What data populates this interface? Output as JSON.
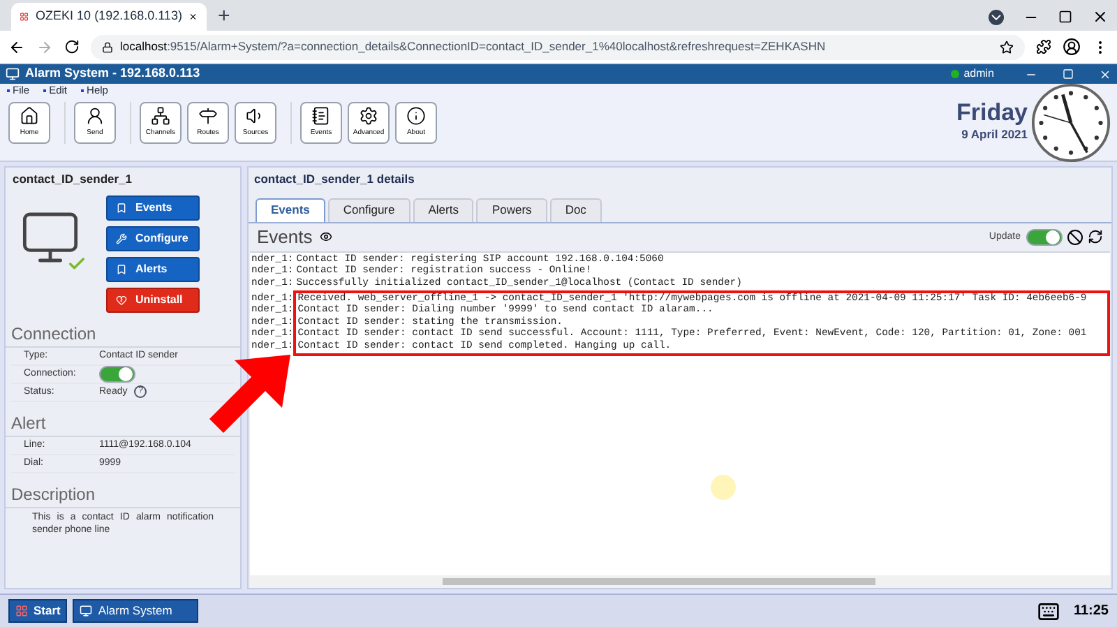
{
  "browser": {
    "tab_title": "OZEKI 10 (192.168.0.113)",
    "new_tab": "+",
    "url_host": "localhost",
    "url_rest": ":9515/Alarm+System/?a=connection_details&ConnectionID=contact_ID_sender_1%40localhost&refreshrequest=ZEHKASHN"
  },
  "app": {
    "title": "Alarm System - 192.168.0.113",
    "user": "admin",
    "user_online": true
  },
  "menu": [
    "File",
    "Edit",
    "Help"
  ],
  "toolbar_groups": [
    [
      {
        "label": "Home",
        "kind": "home"
      }
    ],
    [
      {
        "label": "Send",
        "kind": "send"
      }
    ],
    [
      {
        "label": "Channels",
        "kind": "channels"
      },
      {
        "label": "Routes",
        "kind": "routes"
      },
      {
        "label": "Sources",
        "kind": "sources"
      }
    ],
    [
      {
        "label": "Events",
        "kind": "events"
      },
      {
        "label": "Advanced",
        "kind": "advanced"
      },
      {
        "label": "About",
        "kind": "about"
      }
    ]
  ],
  "date": {
    "day": "Friday",
    "date": "9 April 2021"
  },
  "left": {
    "title": "contact_ID_sender_1",
    "actions": [
      {
        "label": "Events",
        "kind": "primary"
      },
      {
        "label": "Configure",
        "kind": "primary"
      },
      {
        "label": "Alerts",
        "kind": "primary"
      },
      {
        "label": "Uninstall",
        "kind": "danger"
      }
    ],
    "sections": [
      {
        "heading": "Connection",
        "rows": [
          {
            "label": "Type:",
            "kind": "text",
            "value": "Contact ID sender"
          },
          {
            "label": "Connection:",
            "kind": "toggle",
            "on": true
          },
          {
            "label": "Status:",
            "kind": "help",
            "value": "Ready",
            "help": "?"
          }
        ]
      },
      {
        "heading": "Alert",
        "rows": [
          {
            "label": "Line:",
            "kind": "text",
            "value": "1111@192.168.0.104"
          },
          {
            "label": "Dial:",
            "kind": "text",
            "value": "9999"
          }
        ]
      }
    ],
    "description": {
      "heading": "Description",
      "text": "This is a contact ID alarm notification sender phone line"
    }
  },
  "details": {
    "title": "contact_ID_sender_1 details",
    "tabs": [
      {
        "label": "Events",
        "selected": true
      },
      {
        "label": "Configure",
        "selected": false
      },
      {
        "label": "Alerts",
        "selected": false
      },
      {
        "label": "Powers",
        "selected": false
      },
      {
        "label": "Doc",
        "selected": false
      }
    ],
    "heading": "Events",
    "update_label": "Update",
    "update_on": true,
    "log": [
      {
        "prefix": "nder_1:",
        "text": "Contact ID sender: registering SIP account 192.168.0.104:5060",
        "highlighted": false
      },
      {
        "prefix": "nder_1:",
        "text": "Contact ID sender: registration success - Online!",
        "highlighted": false
      },
      {
        "prefix": "nder_1:",
        "text": "Successfully initialized contact_ID_sender_1@localhost (Contact ID sender)",
        "highlighted": false
      },
      {
        "prefix": "nder_1:",
        "text": "Received. web_server_offline_1 -> contact_ID_sender_1 'http://mywebpages.com is offline at 2021-04-09 11:25:17' Task ID: 4eb6eeb6-9",
        "highlighted": true
      },
      {
        "prefix": "nder_1:",
        "text": "Contact ID sender: Dialing number '9999' to send contact ID alaram...",
        "highlighted": true
      },
      {
        "prefix": "nder_1:",
        "text": "Contact ID sender: stating the transmission.",
        "highlighted": true
      },
      {
        "prefix": "nder_1:",
        "text": "Contact ID sender: contact ID send successful. Account: 1111, Type: Preferred, Event: NewEvent, Code: 120, Partition: 01, Zone: 001",
        "highlighted": true
      },
      {
        "prefix": "nder_1:",
        "text": "Contact ID sender: contact ID send completed. Hanging up call.",
        "highlighted": true
      }
    ]
  },
  "taskbar": {
    "start": "Start",
    "window": "Alarm System",
    "time": "11:25"
  }
}
